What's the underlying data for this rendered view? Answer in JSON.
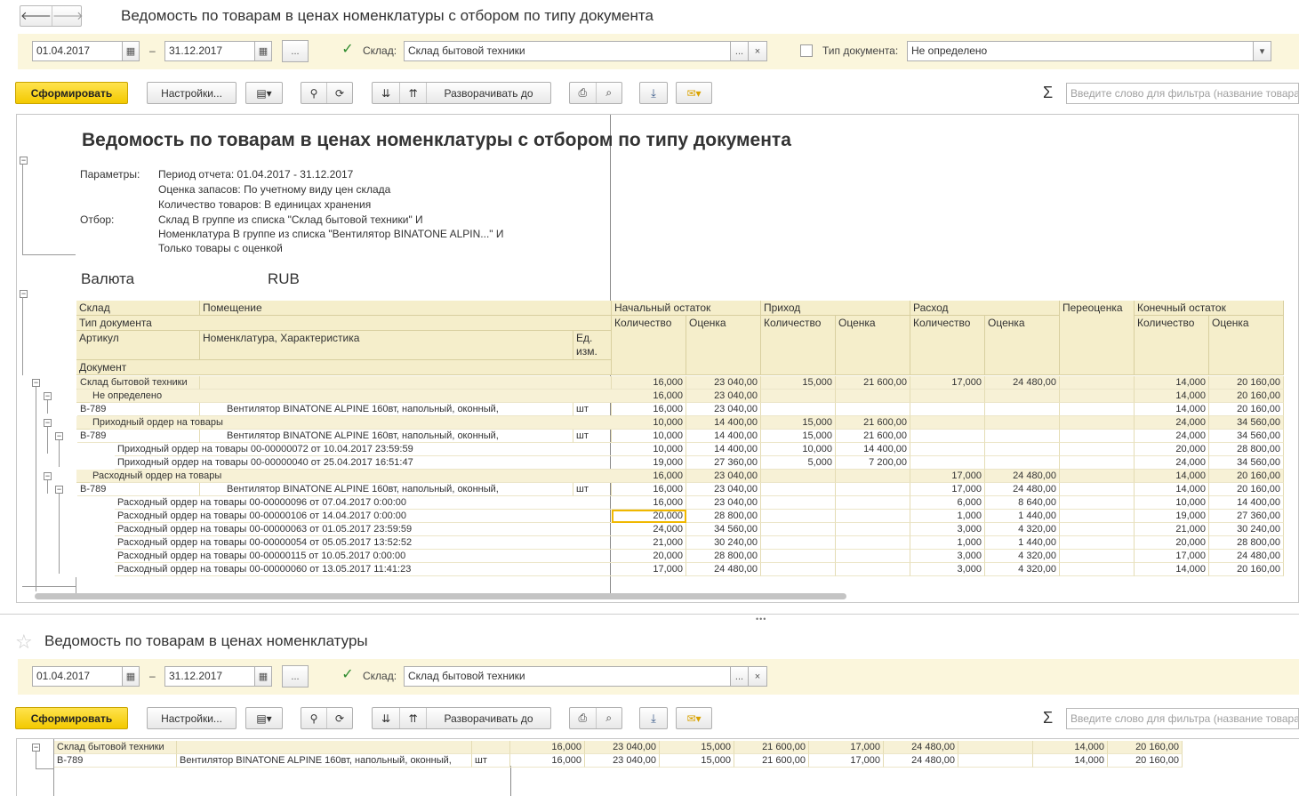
{
  "window": {
    "nav_back": "🡐",
    "nav_forward": "🡒",
    "title": "Ведомость по товарам в ценах номенклатуры с отбором по типу документа"
  },
  "params": {
    "date_from": "01.04.2017",
    "date_sep": "–",
    "date_to": "31.12.2017",
    "more": "...",
    "warehouse_checked": true,
    "warehouse_label": "Склад:",
    "warehouse_value": "Склад бытовой техники",
    "doc_type_checked": false,
    "doc_type_label": "Тип документа:",
    "doc_type_value": "Не определено"
  },
  "toolbar": {
    "generate": "Сформировать",
    "settings": "Настройки...",
    "expand_to": "Разворачивать до",
    "sigma": "Σ",
    "filter_placeholder": "Введите слово для фильтра (название товара"
  },
  "report": {
    "title": "Ведомость по товарам в ценах номенклатуры с отбором по типу документа",
    "params_label": "Параметры:",
    "params": [
      "Период отчета: 01.04.2017 - 31.12.2017",
      "Оценка запасов: По учетному виду цен склада",
      "Количество товаров: В единицах хранения"
    ],
    "filter_label": "Отбор:",
    "filters": [
      "Склад В группе из списка \"Склад бытовой техники\" И",
      "Номенклатура В группе из списка \"Вентилятор BINATONE ALPIN...\" И",
      "Только товары с оценкой"
    ],
    "currency_label": "Валюта",
    "currency": "RUB",
    "headers": {
      "warehouse": "Склад",
      "room": "Помещение",
      "doc_type": "Тип документа",
      "article": "Артикул",
      "nomenclature": "Номенклатура, Характеристика",
      "unit": "Ед.\nизм.",
      "unit_1": "Ед.",
      "unit_2": "изм.",
      "document": "Документ",
      "opening": "Начальный остаток",
      "income": "Приход",
      "expense": "Расход",
      "revaluation": "Переоценка",
      "closing": "Конечный остаток",
      "qty": "Количество",
      "value": "Оценка"
    },
    "rows": [
      {
        "kind": "group",
        "indent": 0,
        "label": "Склад бытовой техники",
        "unit": "",
        "v": [
          "16,000",
          "23 040,00",
          "15,000",
          "21 600,00",
          "17,000",
          "24 480,00",
          "",
          "14,000",
          "20 160,00"
        ]
      },
      {
        "kind": "group",
        "indent": 1,
        "label": "Не определено",
        "unit": "",
        "v": [
          "16,000",
          "23 040,00",
          "",
          "",
          "",
          "",
          "",
          "14,000",
          "20 160,00"
        ]
      },
      {
        "kind": "item",
        "indent": 0,
        "label": "В-789",
        "name": "Вентилятор BINATONE ALPINE 160вт, напольный, оконный,",
        "unit": "шт",
        "v": [
          "16,000",
          "23 040,00",
          "",
          "",
          "",
          "",
          "",
          "14,000",
          "20 160,00"
        ]
      },
      {
        "kind": "group",
        "indent": 1,
        "label": "Приходный ордер на товары",
        "unit": "",
        "v": [
          "10,000",
          "14 400,00",
          "15,000",
          "21 600,00",
          "",
          "",
          "",
          "24,000",
          "34 560,00"
        ]
      },
      {
        "kind": "item",
        "indent": 0,
        "label": "В-789",
        "name": "Вентилятор BINATONE ALPINE 160вт, напольный, оконный,",
        "unit": "шт",
        "v": [
          "10,000",
          "14 400,00",
          "15,000",
          "21 600,00",
          "",
          "",
          "",
          "24,000",
          "34 560,00"
        ]
      },
      {
        "kind": "doc",
        "indent": 2,
        "label": "Приходный ордер на товары 00-00000072 от 10.04.2017 23:59:59",
        "unit": "",
        "v": [
          "10,000",
          "14 400,00",
          "10,000",
          "14 400,00",
          "",
          "",
          "",
          "20,000",
          "28 800,00"
        ]
      },
      {
        "kind": "doc",
        "indent": 2,
        "label": "Приходный ордер на товары 00-00000040 от 25.04.2017 16:51:47",
        "unit": "",
        "v": [
          "19,000",
          "27 360,00",
          "5,000",
          "7 200,00",
          "",
          "",
          "",
          "24,000",
          "34 560,00"
        ]
      },
      {
        "kind": "group",
        "indent": 1,
        "label": "Расходный ордер на товары",
        "unit": "",
        "v": [
          "16,000",
          "23 040,00",
          "",
          "",
          "17,000",
          "24 480,00",
          "",
          "14,000",
          "20 160,00"
        ]
      },
      {
        "kind": "item",
        "indent": 0,
        "label": "В-789",
        "name": "Вентилятор BINATONE ALPINE 160вт, напольный, оконный,",
        "unit": "шт",
        "v": [
          "16,000",
          "23 040,00",
          "",
          "",
          "17,000",
          "24 480,00",
          "",
          "14,000",
          "20 160,00"
        ]
      },
      {
        "kind": "doc",
        "indent": 2,
        "label": "Расходный ордер на товары 00-00000096 от 07.04.2017 0:00:00",
        "unit": "",
        "v": [
          "16,000",
          "23 040,00",
          "",
          "",
          "6,000",
          "8 640,00",
          "",
          "10,000",
          "14 400,00"
        ]
      },
      {
        "kind": "doc",
        "indent": 2,
        "label": "Расходный ордер на товары 00-00000106 от 14.04.2017 0:00:00",
        "unit": "",
        "v": [
          "20,000",
          "28 800,00",
          "",
          "",
          "1,000",
          "1 440,00",
          "",
          "19,000",
          "27 360,00"
        ],
        "selected": true
      },
      {
        "kind": "doc",
        "indent": 2,
        "label": "Расходный ордер на товары 00-00000063 от 01.05.2017 23:59:59",
        "unit": "",
        "v": [
          "24,000",
          "34 560,00",
          "",
          "",
          "3,000",
          "4 320,00",
          "",
          "21,000",
          "30 240,00"
        ]
      },
      {
        "kind": "doc",
        "indent": 2,
        "label": "Расходный ордер на товары 00-00000054 от 05.05.2017 13:52:52",
        "unit": "",
        "v": [
          "21,000",
          "30 240,00",
          "",
          "",
          "1,000",
          "1 440,00",
          "",
          "20,000",
          "28 800,00"
        ]
      },
      {
        "kind": "doc",
        "indent": 2,
        "label": "Расходный ордер на товары 00-00000115 от 10.05.2017 0:00:00",
        "unit": "",
        "v": [
          "20,000",
          "28 800,00",
          "",
          "",
          "3,000",
          "4 320,00",
          "",
          "17,000",
          "24 480,00"
        ]
      },
      {
        "kind": "doc",
        "indent": 2,
        "label": "Расходный ордер на товары 00-00000060 от 13.05.2017 11:41:23",
        "unit": "",
        "v": [
          "17,000",
          "24 480,00",
          "",
          "",
          "3,000",
          "4 320,00",
          "",
          "14,000",
          "20 160,00"
        ]
      }
    ]
  },
  "window2": {
    "title": "Ведомость по товарам в ценах номенклатуры",
    "date_from": "01.04.2017",
    "date_to": "31.12.2017",
    "warehouse_label": "Склад:",
    "warehouse_value": "Склад бытовой техники",
    "rows": [
      {
        "kind": "group",
        "label": "Склад бытовой техники",
        "name": "",
        "unit": "",
        "v": [
          "16,000",
          "23 040,00",
          "15,000",
          "21 600,00",
          "17,000",
          "24 480,00",
          "",
          "14,000",
          "20 160,00"
        ]
      },
      {
        "kind": "item",
        "label": "В-789",
        "name": "Вентилятор BINATONE ALPINE 160вт, напольный, оконный,",
        "unit": "шт",
        "v": [
          "16,000",
          "23 040,00",
          "15,000",
          "21 600,00",
          "17,000",
          "24 480,00",
          "",
          "14,000",
          "20 160,00"
        ]
      }
    ]
  }
}
